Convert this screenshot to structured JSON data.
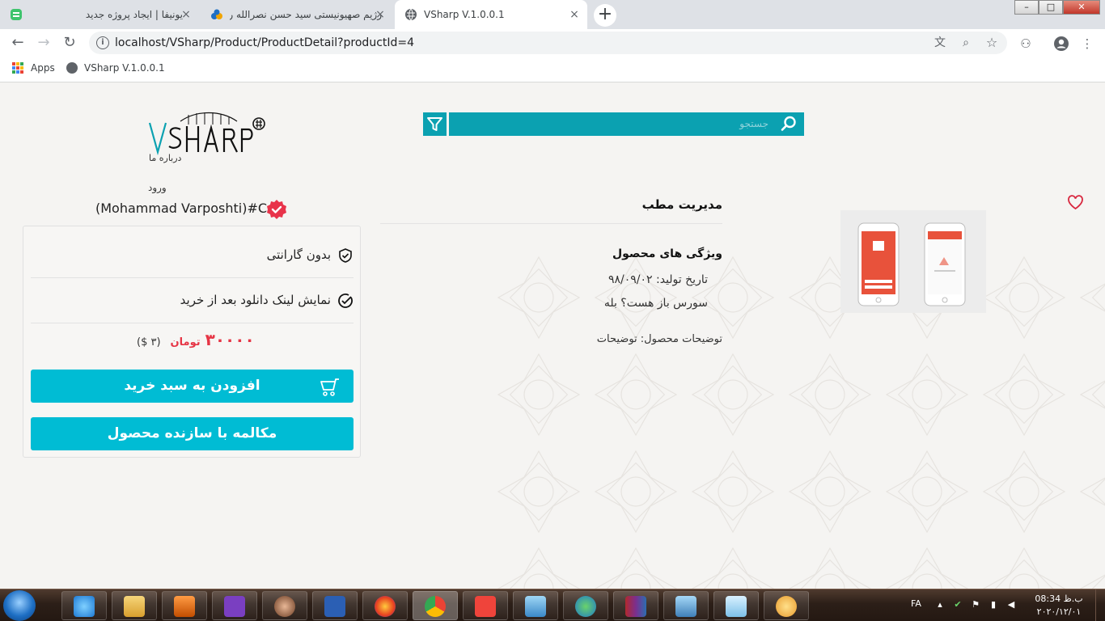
{
  "browser": {
    "tabs": [
      {
        "title": "یونیفا | ایجاد پروژه جدید",
        "active": false
      },
      {
        "title": "رژیم صهیونیستی سید حسن نصرالله را به ...",
        "active": false
      },
      {
        "title": "VSharp V.1.0.0.1",
        "active": true
      }
    ],
    "new_tab_label": "+",
    "close_label": "×",
    "url": "localhost/VSharp/Product/ProductDetail?productId=4",
    "bookmarks": [
      {
        "label": "Apps",
        "icon": "apps-grid-icon"
      },
      {
        "label": "VSharp V.1.0.0.1",
        "icon": "globe-icon"
      }
    ],
    "window_controls": {
      "minimize": "–",
      "maximize": "□",
      "close": "✕"
    }
  },
  "header": {
    "logo_text": "VSHARP",
    "search_placeholder": "جستجو",
    "about_link": "درباره ما",
    "login_link": "ورود",
    "username": "(Mohammad Varposhti)#C"
  },
  "product": {
    "title": "مدیریت مطب",
    "features_heading": "ویژگی های محصول",
    "production_date": "تاریخ تولید: ۹۸/۰۹/۰۲",
    "open_source": "سورس باز هست؟ بله",
    "description": "توضیحات محصول: توضیحات",
    "favorite_icon": "heart-icon"
  },
  "purchase": {
    "warranty": "بدون گارانتی",
    "download_link_note": "نمایش لینک دانلود بعد از خرید",
    "price": "۳۰۰۰۰",
    "currency": "تومان",
    "price_usd": "(۳ $)",
    "add_to_cart": "افزودن به سبد خرید",
    "chat_with_maker": "مکالمه با سازنده محصول"
  },
  "taskbar": {
    "language": "FA",
    "time": "08:34 ب.ظ",
    "date": "۲۰۲۰/۱۲/۰۱",
    "apps": [
      "internet-explorer",
      "file-explorer",
      "media-player",
      "visual-studio",
      "spy-game",
      "word",
      "firefox",
      "chrome",
      "anydesk",
      "remote-desktop",
      "download-manager",
      "winrar",
      "photo-viewer",
      "notepad",
      "paint"
    ]
  },
  "colors": {
    "accent": "#00bcd4",
    "search_teal": "#0ba1b1",
    "price_red": "#e63545",
    "badge_red": "#e8334a"
  }
}
